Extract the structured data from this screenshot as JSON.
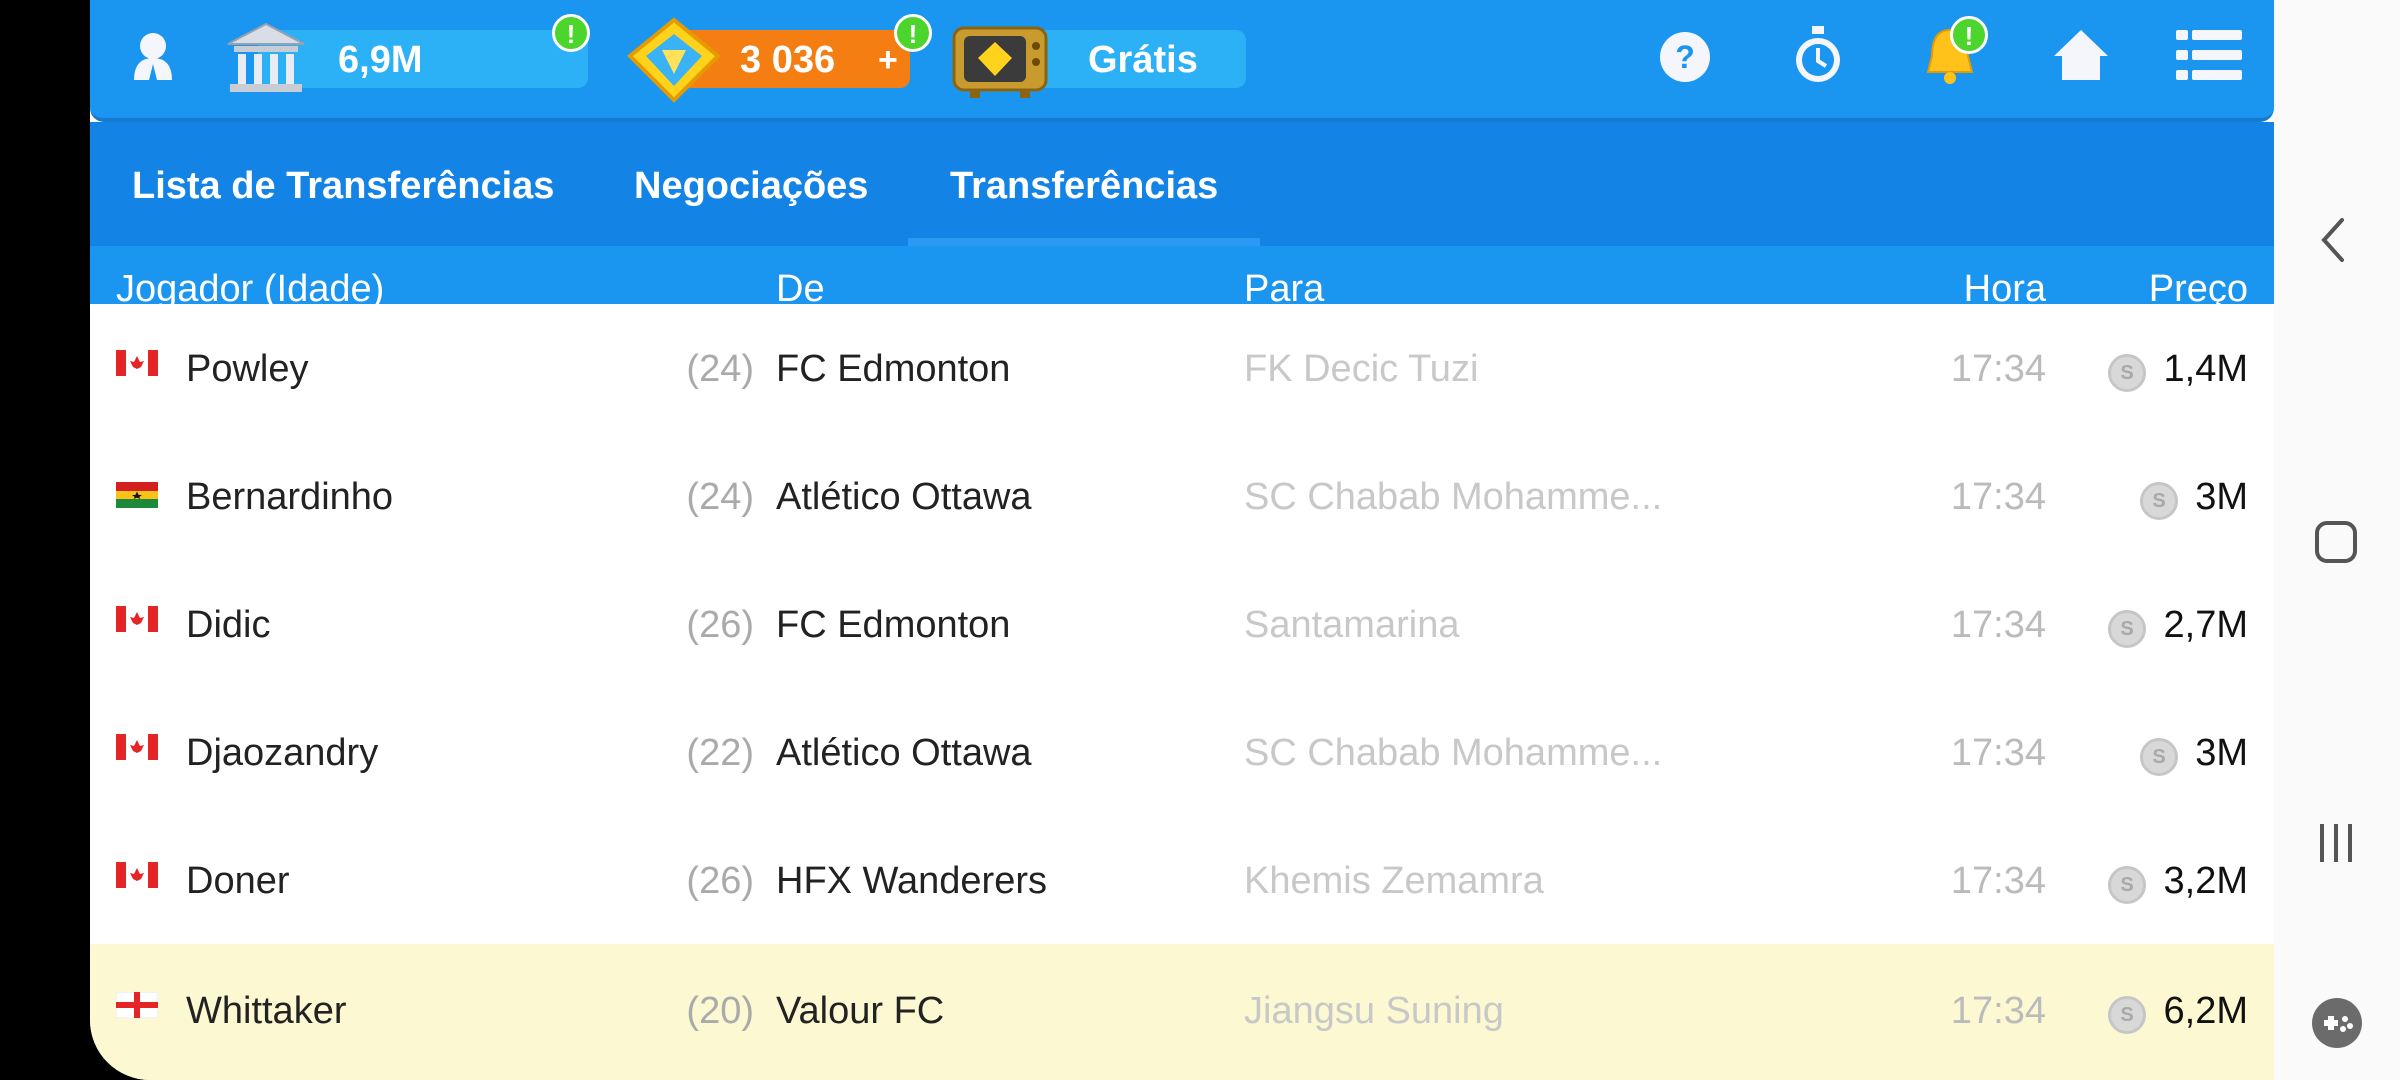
{
  "header": {
    "money": "6,9M",
    "tokens": "3 036",
    "tokens_plus": "+",
    "tv_label": "Grátis",
    "alert_mark": "!",
    "icons": [
      "profile-icon",
      "bank-icon",
      "token-icon",
      "tv-icon",
      "help-icon",
      "stopwatch-icon",
      "bell-icon",
      "home-icon",
      "menu-icon"
    ]
  },
  "tabs": [
    "Lista de Transferências",
    "Negociações",
    "Transferências"
  ],
  "active_tab": "Transferências",
  "columns": {
    "player": "Jogador (Idade)",
    "from": "De",
    "to": "Para",
    "time": "Hora",
    "price": "Preço"
  },
  "rows": [
    {
      "flag": "canada",
      "name": "Powley",
      "age": "(24)",
      "from": "FC Edmonton",
      "to": "FK Decic Tuzi",
      "time": "17:34",
      "price": "1,4M"
    },
    {
      "flag": "ghana",
      "name": "Bernardinho",
      "age": "(24)",
      "from": "Atlético Ottawa",
      "to": "SC Chabab Mohamme...",
      "time": "17:34",
      "price": "3M"
    },
    {
      "flag": "canada",
      "name": "Didic",
      "age": "(26)",
      "from": "FC Edmonton",
      "to": "Santamarina",
      "time": "17:34",
      "price": "2,7M"
    },
    {
      "flag": "canada",
      "name": "Djaozandry",
      "age": "(22)",
      "from": "Atlético Ottawa",
      "to": "SC Chabab Mohamme...",
      "time": "17:34",
      "price": "3M"
    },
    {
      "flag": "canada",
      "name": "Doner",
      "age": "(26)",
      "from": "HFX Wanderers",
      "to": "Khemis Zemamra",
      "time": "17:34",
      "price": "3,2M"
    },
    {
      "flag": "england",
      "name": "Whittaker",
      "age": "(20)",
      "from": "Valour FC",
      "to": "Jiangsu Suning",
      "time": "17:34",
      "price": "6,2M",
      "highlighted": true
    }
  ],
  "colors": {
    "header_blue": "#1a96f0",
    "tab_blue": "#1383e6",
    "highlight_row": "#fcf8d2",
    "badge_green": "#4cd52c",
    "token_orange": "#f57e12"
  },
  "system_nav": [
    "back-icon",
    "home-button-icon",
    "recents-icon",
    "game-tools-icon"
  ]
}
